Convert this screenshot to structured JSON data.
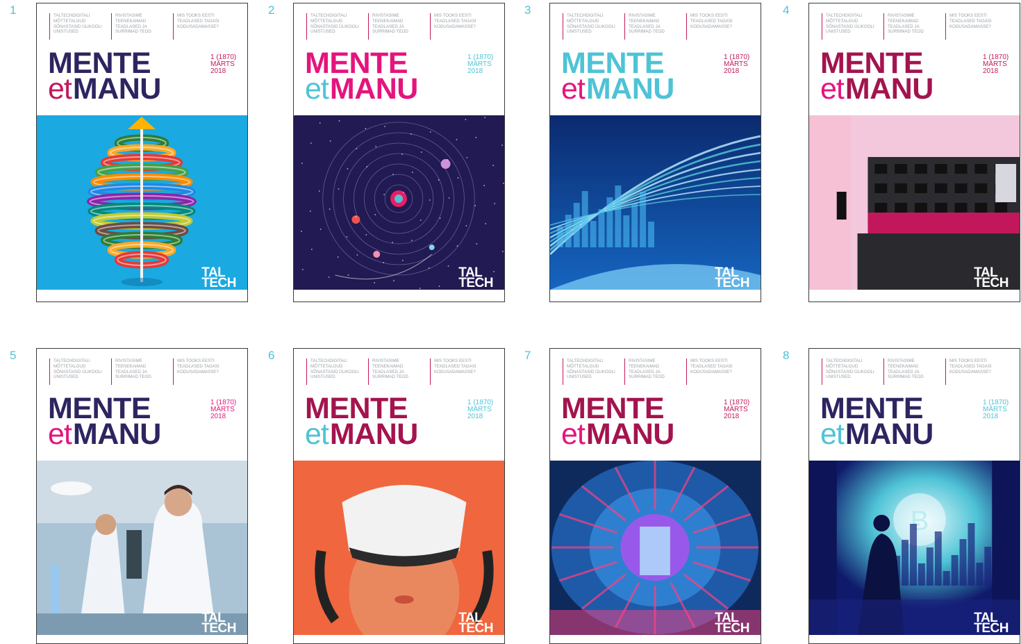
{
  "covers": [
    {
      "number": "1",
      "teasers": [
        [
          "TALTECHDIGITALI",
          "MÕTTETALGUD",
          "SÕNASTASID ÜLIKOOLI",
          "UNISTUSED"
        ],
        [
          "RIVISTASIME",
          "TEENEKAIMAD",
          "TEADLASED JA",
          "SURRIMAD TEOD"
        ],
        [
          "MIS TOOKS EESTI",
          "TEADLASED TAGASI",
          "KODUSADAMASSE?"
        ]
      ],
      "title_top": "MENTE",
      "title_et": "et",
      "title_bottom": "MANU",
      "issue": [
        "1 (1870)",
        "MÄRTS",
        "2018"
      ],
      "logo": [
        "TAL",
        "TECH"
      ],
      "image": "dna-helix-illustration",
      "colors": {
        "title": "#2d2560",
        "et": "#c2185b",
        "issue": "#c2185b"
      }
    },
    {
      "number": "2",
      "teasers": [
        [
          "TALTECHDIGITALI",
          "MÕTTETALGUD",
          "SÕNASTASID ÜLIKOOLI",
          "UNISTUSED"
        ],
        [
          "RIVISTASIME",
          "TEENEKAIMAD",
          "TEADLASED JA",
          "SURRIMAD TEOD"
        ],
        [
          "MIS TOOKS EESTI",
          "TEADLASED TAGASI",
          "KODUSADAMASSE?"
        ]
      ],
      "title_top": "MENTE",
      "title_et": "et",
      "title_bottom": "MANU",
      "issue": [
        "1 (1870)",
        "MÄRTS",
        "2018"
      ],
      "logo": [
        "TAL",
        "TECH"
      ],
      "image": "solar-system-illustration",
      "colors": {
        "title": "#e5147d",
        "et": "#4ec3d6",
        "issue": "#4ec3d6"
      }
    },
    {
      "number": "3",
      "teasers": [
        [
          "TALTECHDIGITALI",
          "MÕTTETALGUD",
          "SÕNASTASID ÜLIKOOLI",
          "UNISTUSED"
        ],
        [
          "RIVISTASIME",
          "TEENEKAIMAD",
          "TEADLASED JA",
          "SURRIMAD TEOD"
        ],
        [
          "MIS TOOKS EESTI",
          "TEADLASED TAGASI",
          "KODUSADAMASSE?"
        ]
      ],
      "title_top": "MENTE",
      "title_et": "et",
      "title_bottom": "MANU",
      "issue": [
        "1 (1870)",
        "MÄRTS",
        "2018"
      ],
      "logo": [
        "TAL",
        "TECH"
      ],
      "image": "light-trails-city",
      "colors": {
        "title": "#4ec3d6",
        "et": "#e5147d",
        "issue": "#c2185b"
      }
    },
    {
      "number": "4",
      "teasers": [
        [
          "TALTECHDIGITALI",
          "MÕTTETALGUD",
          "SÕNASTASID ÜLIKOOLI",
          "UNISTUSED"
        ],
        [
          "RIVISTASIME",
          "TEENEKAIMAD",
          "TEADLASED JA",
          "SURRIMAD TEOD"
        ],
        [
          "MIS TOOKS EESTI",
          "TEADLASED TAGASI",
          "KODUSADAMASSE?"
        ]
      ],
      "title_top": "MENTE",
      "title_et": "et",
      "title_bottom": "MANU",
      "issue": [
        "1 (1870)",
        "MÄRTS",
        "2018"
      ],
      "logo": [
        "TAL",
        "TECH"
      ],
      "image": "control-panel-pink",
      "colors": {
        "title": "#a3144e",
        "et": "#e5147d",
        "issue": "#c2185b"
      }
    },
    {
      "number": "5",
      "teasers": [
        [
          "TALTECHDIGITALI",
          "MÕTTETALGUD",
          "SÕNASTASID ÜLIKOOLI",
          "UNISTUSED"
        ],
        [
          "RIVISTASIME",
          "TEENEKAIMAD",
          "TEADLASED JA",
          "SURRIMAD TEOD"
        ],
        [
          "MIS TOOKS EESTI",
          "TEADLASED TAGASI",
          "KODUSADAMASSE?"
        ]
      ],
      "title_top": "MENTE",
      "title_et": "et",
      "title_bottom": "MANU",
      "issue": [
        "1 (1870)",
        "MÄRTS",
        "2018"
      ],
      "logo": [
        "TAL",
        "TECH"
      ],
      "image": "laboratory-scientists",
      "colors": {
        "title": "#2d2560",
        "et": "#e5147d",
        "issue": "#e5147d"
      }
    },
    {
      "number": "6",
      "teasers": [
        [
          "TALTECHDIGITALI",
          "MÕTTETALGUD",
          "SÕNASTASID ÜLIKOOLI",
          "UNISTUSED"
        ],
        [
          "RIVISTASIME",
          "TEENEKAIMAD",
          "TEADLASED JA",
          "SURRIMAD TEOD"
        ],
        [
          "MIS TOOKS EESTI",
          "TEADLASED TAGASI",
          "KODUSADAMASSE?"
        ]
      ],
      "title_top": "MENTE",
      "title_et": "et",
      "title_bottom": "MANU",
      "issue": [
        "1 (1870)",
        "MÄRTS",
        "2018"
      ],
      "logo": [
        "TAL",
        "TECH"
      ],
      "image": "vr-headset-person",
      "colors": {
        "title": "#a3144e",
        "et": "#4ec3d6",
        "issue": "#4ec3d6"
      }
    },
    {
      "number": "7",
      "teasers": [
        [
          "TALTECHDIGITALI",
          "MÕTTETALGUD",
          "SÕNASTASID ÜLIKOOLI",
          "UNISTUSED"
        ],
        [
          "RIVISTASIME",
          "TEENEKAIMAD",
          "TEADLASED JA",
          "SURRIMAD TEOD"
        ],
        [
          "MIS TOOKS EESTI",
          "TEADLASED TAGASI",
          "KODUSADAMASSE?"
        ]
      ],
      "title_top": "MENTE",
      "title_et": "et",
      "title_bottom": "MANU",
      "issue": [
        "1 (1870)",
        "MÄRTS",
        "2018"
      ],
      "logo": [
        "TAL",
        "TECH"
      ],
      "image": "reactor-tunnel",
      "colors": {
        "title": "#a3144e",
        "et": "#e5147d",
        "issue": "#c2185b"
      }
    },
    {
      "number": "8",
      "teasers": [
        [
          "TALTECHDIGITALI",
          "MÕTTETALGUD",
          "SÕNASTASID ÜLIKOOLI",
          "UNISTUSED"
        ],
        [
          "RIVISTASIME",
          "TEENEKAIMAD",
          "TEADLASED JA",
          "SURRIMAD TEOD"
        ],
        [
          "MIS TOOKS EESTI",
          "TEADLASED TAGASI",
          "KODUSADAMASSE?"
        ]
      ],
      "title_top": "MENTE",
      "title_et": "et",
      "title_bottom": "MANU",
      "issue": [
        "1 (1870)",
        "MÄRTS",
        "2018"
      ],
      "logo": [
        "TAL",
        "TECH"
      ],
      "image": "bitcoin-city-figure",
      "colors": {
        "title": "#2d2560",
        "et": "#4ec3d6",
        "issue": "#4ec3d6"
      }
    }
  ]
}
